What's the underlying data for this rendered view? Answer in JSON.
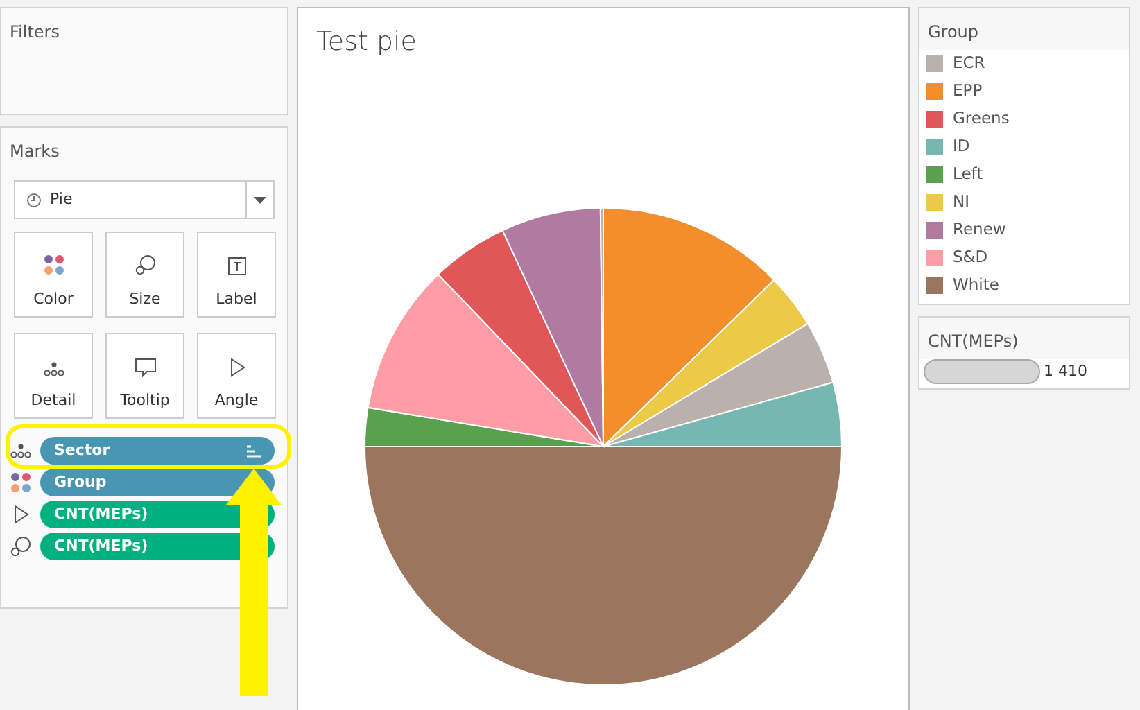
{
  "filters": {
    "title": "Filters"
  },
  "marks": {
    "title": "Marks",
    "mark_type": "Pie",
    "cards": [
      {
        "label": "Color",
        "kind": "color"
      },
      {
        "label": "Size",
        "kind": "size"
      },
      {
        "label": "Label",
        "kind": "label"
      },
      {
        "label": "Detail",
        "kind": "detail"
      },
      {
        "label": "Tooltip",
        "kind": "tooltip"
      },
      {
        "label": "Angle",
        "kind": "angle"
      }
    ],
    "shelf": [
      {
        "label": "Sector",
        "kind": "detail",
        "color": "#4996b2",
        "sort": true
      },
      {
        "label": "Group",
        "kind": "color",
        "color": "#4996b2"
      },
      {
        "label": "CNT(MEPs)",
        "kind": "angle",
        "color": "#00b180"
      },
      {
        "label": "CNT(MEPs)",
        "kind": "size",
        "color": "#00b180"
      }
    ]
  },
  "chart": {
    "title": "Test pie"
  },
  "legend": {
    "title": "Group",
    "items": [
      {
        "label": "ECR",
        "color": "#bab0ac"
      },
      {
        "label": "EPP",
        "color": "#f28e2b"
      },
      {
        "label": "Greens",
        "color": "#e15759"
      },
      {
        "label": "ID",
        "color": "#76b7b2"
      },
      {
        "label": "Left",
        "color": "#59a14f"
      },
      {
        "label": "NI",
        "color": "#edc948"
      },
      {
        "label": "Renew",
        "color": "#b07aa1"
      },
      {
        "label": "S&D",
        "color": "#ff9da7"
      },
      {
        "label": "White",
        "color": "#9c755f"
      }
    ]
  },
  "size_legend": {
    "title": "CNT(MEPs)",
    "value": "1 410"
  }
}
